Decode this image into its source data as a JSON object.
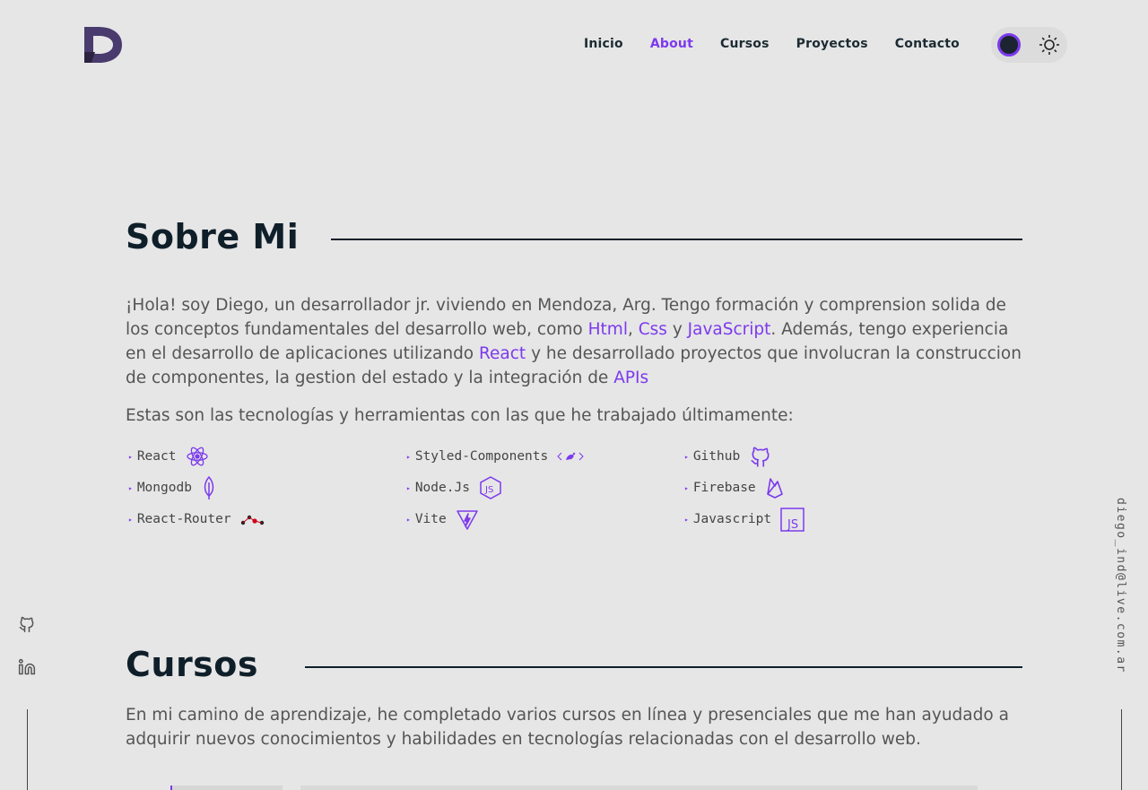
{
  "nav": {
    "items": [
      "Inicio",
      "About",
      "Cursos",
      "Proyectos",
      "Contacto"
    ],
    "active": "About"
  },
  "theme": {
    "dark_icon": "moon-icon",
    "light_icon": "sun-icon"
  },
  "about": {
    "title": "Sobre Mi",
    "p1": [
      {
        "t": "¡Hola! soy Diego, un desarrollador jr. viviendo en Mendoza, Arg. Tengo formación y comprension solida de los conceptos fundamentales del desarrollo web, como ",
        "h": false
      },
      {
        "t": "Html",
        "h": true
      },
      {
        "t": ", ",
        "h": false
      },
      {
        "t": "Css",
        "h": true
      },
      {
        "t": " y ",
        "h": false
      },
      {
        "t": "JavaScript",
        "h": true
      },
      {
        "t": ". Además, tengo experiencia en el desarrollo de aplicaciones utilizando ",
        "h": false
      },
      {
        "t": "React",
        "h": true
      },
      {
        "t": " y he desarrollado proyectos que involucran la construccion de componentes, la gestion del estado y la integración de ",
        "h": false
      },
      {
        "t": "APIs",
        "h": true
      }
    ],
    "p2": "Estas son las tecnologías y herramientas con las que he trabajado últimamente:",
    "techs": [
      {
        "label": "React",
        "icon": "react-icon"
      },
      {
        "label": "Styled-Components",
        "icon": "styled-components-icon"
      },
      {
        "label": "Github",
        "icon": "github-icon"
      },
      {
        "label": "Mongodb",
        "icon": "mongodb-icon"
      },
      {
        "label": "Node.Js",
        "icon": "nodejs-icon"
      },
      {
        "label": "Firebase",
        "icon": "firebase-icon"
      },
      {
        "label": "React-Router",
        "icon": "react-router-icon"
      },
      {
        "label": "Vite",
        "icon": "vite-icon"
      },
      {
        "label": "Javascript",
        "icon": "javascript-icon"
      }
    ]
  },
  "courses": {
    "title": "Cursos",
    "p1": "En mi camino de aprendizaje, he completado varios cursos en línea y presenciales que me han ayudado a adquirir nuevos conocimientos y habilidades en tecnologías relacionadas con el desarrollo web."
  },
  "sidebar": {
    "email": "diego_ind@live.com.ar",
    "social": [
      "github-icon",
      "linkedin-icon"
    ]
  },
  "colors": {
    "accent": "#7c3aed",
    "background": "#e6e6e6",
    "heading": "#0f1f2a"
  }
}
